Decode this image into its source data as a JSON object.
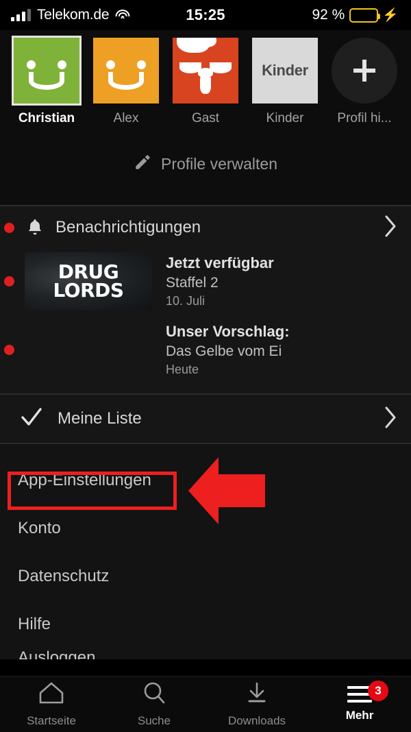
{
  "statusbar": {
    "carrier": "Telekom.de",
    "time": "15:25",
    "battery_percent": "92 %",
    "signal_icon": "signal-bars-icon",
    "wifi_icon": "wifi-icon",
    "battery_icon": "battery-icon",
    "charging_icon": "lightning-bolt-icon",
    "battery_color": "#f5c518"
  },
  "profiles": {
    "items": [
      {
        "name": "Christian",
        "type": "smiley",
        "color": "#7fb238",
        "selected": true
      },
      {
        "name": "Alex",
        "type": "smiley",
        "color": "#eda024",
        "selected": false
      },
      {
        "name": "Gast",
        "type": "mustache-face",
        "color": "#d8441f",
        "selected": false
      },
      {
        "name": "Kinder",
        "type": "kinder-label",
        "color": "#d9d9d9",
        "label": "Kinder",
        "selected": false
      },
      {
        "name": "Profil hi...",
        "type": "add-profile",
        "color": "#1f1f1f",
        "selected": false
      }
    ],
    "manage_label": "Profile verwalten",
    "manage_icon": "pencil-icon"
  },
  "notifications": {
    "header_label": "Benachrichtigungen",
    "header_icon": "bell-icon",
    "chevron_icon": "chevron-right-icon",
    "items": [
      {
        "title": "Jetzt verfügbar",
        "subtitle": "Staffel 2",
        "date": "10. Juli",
        "thumb_line1": "DRUG",
        "thumb_line2": "LORDS",
        "unread": true
      },
      {
        "title": "Unser Vorschlag:",
        "subtitle": "Das Gelbe vom Ei",
        "date": "Heute",
        "unread": true
      }
    ],
    "unread_dot_color": "#e02020"
  },
  "mylist": {
    "label": "Meine Liste",
    "check_icon": "checkmark-icon",
    "chevron_icon": "chevron-right-icon"
  },
  "menu": {
    "items": [
      {
        "label": "App-Einstellungen",
        "highlighted": true
      },
      {
        "label": "Konto",
        "highlighted": false
      },
      {
        "label": "Datenschutz",
        "highlighted": false
      },
      {
        "label": "Hilfe",
        "highlighted": false
      }
    ],
    "clipped_item_label": "Ausloggen"
  },
  "annotation": {
    "highlight_color": "#ee1f1f",
    "box_target": "App-Einstellungen",
    "arrow_icon": "left-arrow-annotation"
  },
  "tabbar": {
    "items": [
      {
        "label": "Startseite",
        "icon": "home-icon",
        "active": false,
        "badge": ""
      },
      {
        "label": "Suche",
        "icon": "search-icon",
        "active": false,
        "badge": ""
      },
      {
        "label": "Downloads",
        "icon": "download-icon",
        "active": false,
        "badge": ""
      },
      {
        "label": "Mehr",
        "icon": "hamburger-icon",
        "active": true,
        "badge": "3"
      }
    ],
    "badge_color": "#e50914"
  }
}
